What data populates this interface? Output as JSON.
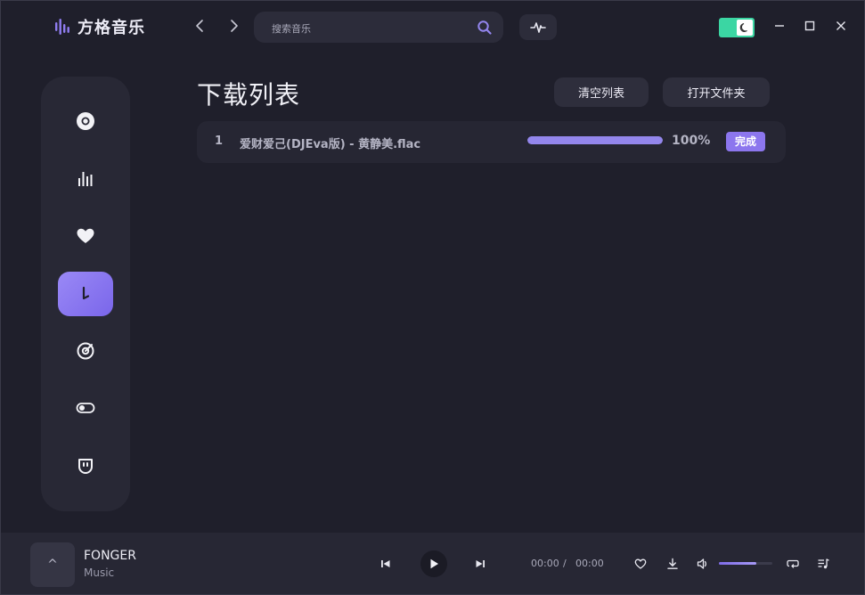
{
  "app": {
    "name": "方格音乐",
    "accent": "#8c76ee",
    "toggle_color": "#3bd6a3"
  },
  "search": {
    "placeholder": "搜索音乐",
    "icon": "search-icon"
  },
  "titlebar": {
    "icons": [
      "chevron-left-icon",
      "chevron-right-icon",
      "waveform-icon",
      "moon-icon",
      "minimize-icon",
      "maximize-icon",
      "close-icon"
    ]
  },
  "sidebar": {
    "items": [
      {
        "icon": "disc-icon",
        "active": false
      },
      {
        "icon": "chart-bars-icon",
        "active": false
      },
      {
        "icon": "heart-icon",
        "active": false
      },
      {
        "icon": "download-icon",
        "active": true
      },
      {
        "icon": "target-icon",
        "active": false
      },
      {
        "icon": "toggle-icon",
        "active": false
      },
      {
        "icon": "face-icon",
        "active": false
      }
    ]
  },
  "main": {
    "title": "下载列表",
    "clear_label": "清空列表",
    "open_folder_label": "打开文件夹",
    "downloads": [
      {
        "index": "1",
        "name": "爱财爱己(DJEva版) - 黄静美.flac",
        "progress": 100,
        "percent_label": "100%",
        "status": "完成"
      }
    ]
  },
  "player": {
    "cover_glyph": "^",
    "title": "FONGER",
    "artist": "Music",
    "current_time": "00:00",
    "separator": "/",
    "total_time": "00:00",
    "volume": 0.7
  }
}
